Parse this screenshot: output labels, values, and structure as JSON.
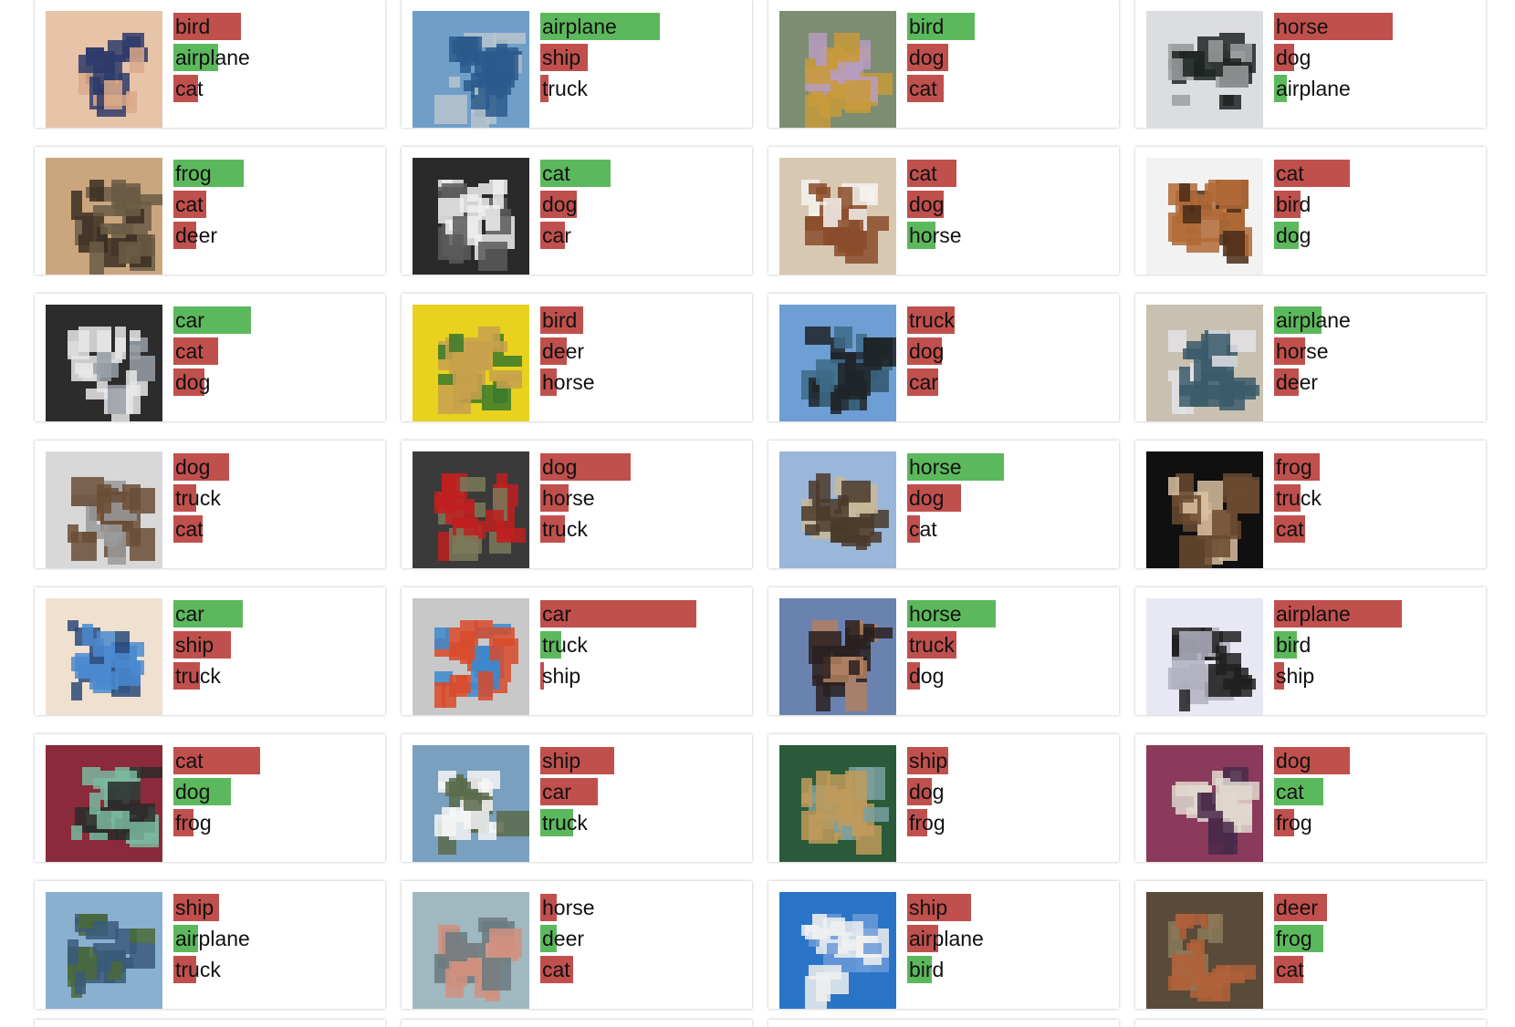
{
  "colors": {
    "correct": "#5cb85c",
    "incorrect": "#c0504d",
    "card_bg": "#ffffff"
  },
  "cards": [
    {
      "image": "thumbnail",
      "predictions": [
        {
          "label": "bird",
          "confidence": 0.41,
          "correct": false
        },
        {
          "label": "airplane",
          "confidence": 0.27,
          "correct": true
        },
        {
          "label": "cat",
          "confidence": 0.15,
          "correct": false
        }
      ]
    },
    {
      "image": "thumbnail",
      "predictions": [
        {
          "label": "airplane",
          "confidence": 0.73,
          "correct": true
        },
        {
          "label": "ship",
          "confidence": 0.29,
          "correct": false
        },
        {
          "label": "truck",
          "confidence": 0.05,
          "correct": false
        }
      ]
    },
    {
      "image": "thumbnail",
      "predictions": [
        {
          "label": "bird",
          "confidence": 0.41,
          "correct": true
        },
        {
          "label": "dog",
          "confidence": 0.25,
          "correct": false
        },
        {
          "label": "cat",
          "confidence": 0.22,
          "correct": false
        }
      ]
    },
    {
      "image": "thumbnail",
      "predictions": [
        {
          "label": "horse",
          "confidence": 0.72,
          "correct": false
        },
        {
          "label": "dog",
          "confidence": 0.12,
          "correct": false
        },
        {
          "label": "airplane",
          "confidence": 0.08,
          "correct": true
        }
      ]
    },
    {
      "image": "thumbnail",
      "predictions": [
        {
          "label": "frog",
          "confidence": 0.43,
          "correct": true
        },
        {
          "label": "cat",
          "confidence": 0.2,
          "correct": false
        },
        {
          "label": "deer",
          "confidence": 0.14,
          "correct": false
        }
      ]
    },
    {
      "image": "thumbnail",
      "predictions": [
        {
          "label": "cat",
          "confidence": 0.43,
          "correct": true
        },
        {
          "label": "dog",
          "confidence": 0.22,
          "correct": false
        },
        {
          "label": "car",
          "confidence": 0.15,
          "correct": false
        }
      ]
    },
    {
      "image": "thumbnail",
      "predictions": [
        {
          "label": "cat",
          "confidence": 0.3,
          "correct": false
        },
        {
          "label": "dog",
          "confidence": 0.22,
          "correct": false
        },
        {
          "label": "horse",
          "confidence": 0.17,
          "correct": true
        }
      ]
    },
    {
      "image": "thumbnail",
      "predictions": [
        {
          "label": "cat",
          "confidence": 0.46,
          "correct": false
        },
        {
          "label": "bird",
          "confidence": 0.16,
          "correct": false
        },
        {
          "label": "dog",
          "confidence": 0.15,
          "correct": true
        }
      ]
    },
    {
      "image": "thumbnail",
      "predictions": [
        {
          "label": "car",
          "confidence": 0.47,
          "correct": true
        },
        {
          "label": "cat",
          "confidence": 0.27,
          "correct": false
        },
        {
          "label": "dog",
          "confidence": 0.19,
          "correct": false
        }
      ]
    },
    {
      "image": "thumbnail",
      "predictions": [
        {
          "label": "bird",
          "confidence": 0.26,
          "correct": false
        },
        {
          "label": "deer",
          "confidence": 0.16,
          "correct": false
        },
        {
          "label": "horse",
          "confidence": 0.1,
          "correct": false
        }
      ]
    },
    {
      "image": "thumbnail",
      "predictions": [
        {
          "label": "truck",
          "confidence": 0.29,
          "correct": false
        },
        {
          "label": "dog",
          "confidence": 0.21,
          "correct": false
        },
        {
          "label": "car",
          "confidence": 0.19,
          "correct": false
        }
      ]
    },
    {
      "image": "thumbnail",
      "predictions": [
        {
          "label": "airplane",
          "confidence": 0.29,
          "correct": true
        },
        {
          "label": "horse",
          "confidence": 0.19,
          "correct": false
        },
        {
          "label": "deer",
          "confidence": 0.15,
          "correct": false
        }
      ]
    },
    {
      "image": "thumbnail",
      "predictions": [
        {
          "label": "dog",
          "confidence": 0.34,
          "correct": false
        },
        {
          "label": "truck",
          "confidence": 0.14,
          "correct": false
        },
        {
          "label": "cat",
          "confidence": 0.18,
          "correct": false
        }
      ]
    },
    {
      "image": "thumbnail",
      "predictions": [
        {
          "label": "dog",
          "confidence": 0.55,
          "correct": false
        },
        {
          "label": "horse",
          "confidence": 0.17,
          "correct": false
        },
        {
          "label": "truck",
          "confidence": 0.15,
          "correct": false
        }
      ]
    },
    {
      "image": "thumbnail",
      "predictions": [
        {
          "label": "horse",
          "confidence": 0.59,
          "correct": true
        },
        {
          "label": "dog",
          "confidence": 0.33,
          "correct": false
        },
        {
          "label": "cat",
          "confidence": 0.08,
          "correct": false
        }
      ]
    },
    {
      "image": "thumbnail",
      "predictions": [
        {
          "label": "frog",
          "confidence": 0.28,
          "correct": false
        },
        {
          "label": "truck",
          "confidence": 0.16,
          "correct": false
        },
        {
          "label": "cat",
          "confidence": 0.19,
          "correct": false
        }
      ]
    },
    {
      "image": "thumbnail",
      "predictions": [
        {
          "label": "car",
          "confidence": 0.42,
          "correct": true
        },
        {
          "label": "ship",
          "confidence": 0.35,
          "correct": false
        },
        {
          "label": "truck",
          "confidence": 0.16,
          "correct": false
        }
      ]
    },
    {
      "image": "thumbnail",
      "predictions": [
        {
          "label": "car",
          "confidence": 0.95,
          "correct": false
        },
        {
          "label": "truck",
          "confidence": 0.13,
          "correct": true
        },
        {
          "label": "ship",
          "confidence": 0.02,
          "correct": false
        }
      ]
    },
    {
      "image": "thumbnail",
      "predictions": [
        {
          "label": "horse",
          "confidence": 0.54,
          "correct": true
        },
        {
          "label": "truck",
          "confidence": 0.3,
          "correct": false
        },
        {
          "label": "dog",
          "confidence": 0.08,
          "correct": false
        }
      ]
    },
    {
      "image": "thumbnail",
      "predictions": [
        {
          "label": "airplane",
          "confidence": 0.78,
          "correct": false
        },
        {
          "label": "bird",
          "confidence": 0.14,
          "correct": true
        },
        {
          "label": "ship",
          "confidence": 0.06,
          "correct": false
        }
      ]
    },
    {
      "image": "thumbnail",
      "predictions": [
        {
          "label": "cat",
          "confidence": 0.53,
          "correct": false
        },
        {
          "label": "dog",
          "confidence": 0.35,
          "correct": true
        },
        {
          "label": "frog",
          "confidence": 0.12,
          "correct": false
        }
      ]
    },
    {
      "image": "thumbnail",
      "predictions": [
        {
          "label": "ship",
          "confidence": 0.45,
          "correct": false
        },
        {
          "label": "car",
          "confidence": 0.35,
          "correct": false
        },
        {
          "label": "truck",
          "confidence": 0.2,
          "correct": true
        }
      ]
    },
    {
      "image": "thumbnail",
      "predictions": [
        {
          "label": "ship",
          "confidence": 0.25,
          "correct": false
        },
        {
          "label": "dog",
          "confidence": 0.15,
          "correct": false
        },
        {
          "label": "frog",
          "confidence": 0.12,
          "correct": false
        }
      ]
    },
    {
      "image": "thumbnail",
      "predictions": [
        {
          "label": "dog",
          "confidence": 0.46,
          "correct": false
        },
        {
          "label": "cat",
          "confidence": 0.3,
          "correct": true
        },
        {
          "label": "frog",
          "confidence": 0.12,
          "correct": false
        }
      ]
    },
    {
      "image": "thumbnail",
      "predictions": [
        {
          "label": "ship",
          "confidence": 0.28,
          "correct": false
        },
        {
          "label": "airplane",
          "confidence": 0.15,
          "correct": true
        },
        {
          "label": "truck",
          "confidence": 0.14,
          "correct": false
        }
      ]
    },
    {
      "image": "thumbnail",
      "predictions": [
        {
          "label": "horse",
          "confidence": 0.1,
          "correct": false
        },
        {
          "label": "deer",
          "confidence": 0.1,
          "correct": true
        },
        {
          "label": "cat",
          "confidence": 0.2,
          "correct": false
        }
      ]
    },
    {
      "image": "thumbnail",
      "predictions": [
        {
          "label": "ship",
          "confidence": 0.39,
          "correct": false
        },
        {
          "label": "airplane",
          "confidence": 0.19,
          "correct": false
        },
        {
          "label": "bird",
          "confidence": 0.15,
          "correct": true
        }
      ]
    },
    {
      "image": "thumbnail",
      "predictions": [
        {
          "label": "deer",
          "confidence": 0.32,
          "correct": false
        },
        {
          "label": "frog",
          "confidence": 0.3,
          "correct": true
        },
        {
          "label": "cat",
          "confidence": 0.18,
          "correct": false
        }
      ]
    }
  ]
}
